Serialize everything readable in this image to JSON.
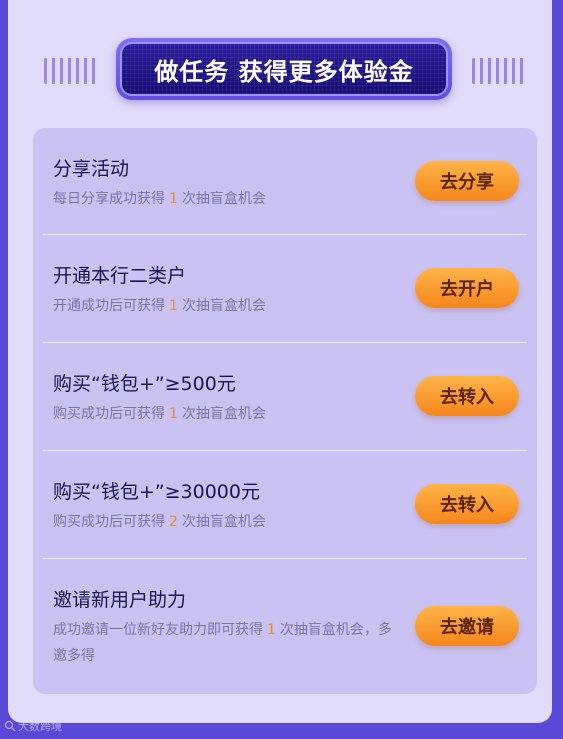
{
  "header": {
    "title": "做任务 获得更多体验金"
  },
  "tasks": [
    {
      "title": "分享活动",
      "desc_prefix": "每日分享成功获得",
      "count": "1",
      "desc_suffix": "次抽盲盒机会",
      "button": "去分享"
    },
    {
      "title": "开通本行二类户",
      "desc_prefix": "开通成功后可获得",
      "count": "1",
      "desc_suffix": "次抽盲盒机会",
      "button": "去开户"
    },
    {
      "title": "购买“钱包+”≥500元",
      "desc_prefix": "购买成功后可获得",
      "count": "1",
      "desc_suffix": "次抽盲盒机会",
      "button": "去转入"
    },
    {
      "title": "购买“钱包+”≥30000元",
      "desc_prefix": "购买成功后可获得",
      "count": "2",
      "desc_suffix": "次抽盲盒机会",
      "button": "去转入"
    },
    {
      "title": "邀请新用户助力",
      "desc_prefix": "成功邀请一位新好友助力即可获得",
      "count": "1",
      "desc_suffix": "次抽盲盒机会，多邀多得",
      "button": "去邀请"
    }
  ],
  "watermark": {
    "icon": "magnifier-icon",
    "text": "大数跨境"
  },
  "colors": {
    "background": "#5a48d6",
    "card": "#e2dcfb",
    "panel": "#c9c2f3",
    "title_bg": "#1e1284",
    "button": "#f5861c",
    "count_highlight": "#f08a24"
  }
}
